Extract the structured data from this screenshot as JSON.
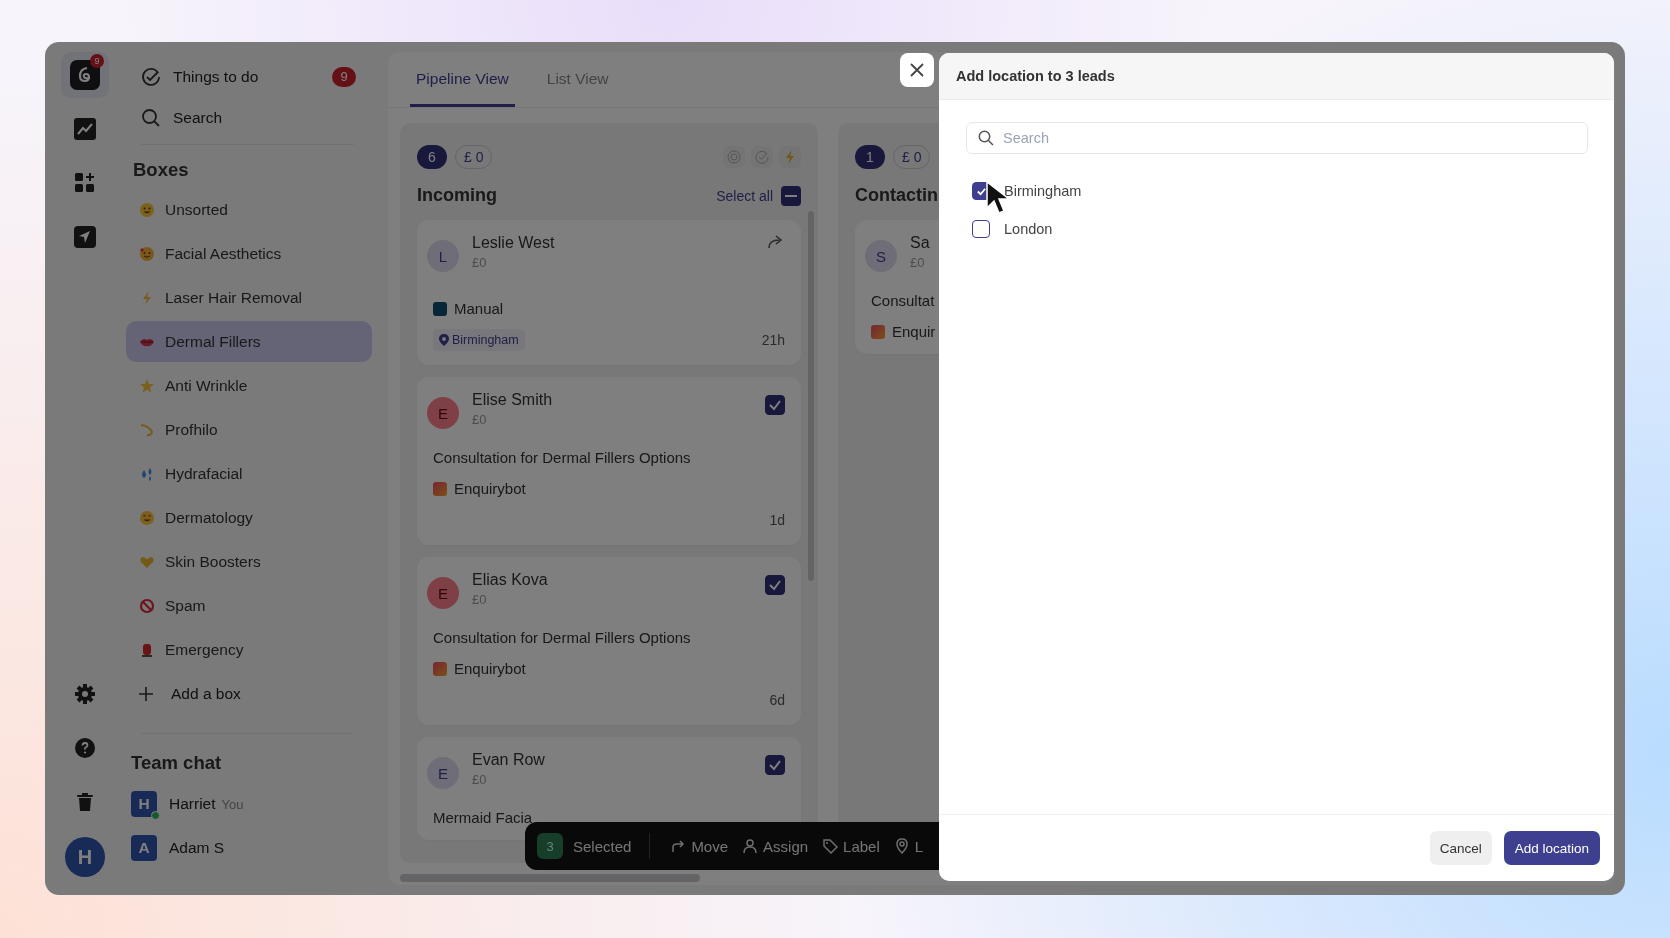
{
  "rail": {
    "logo_badge": "9",
    "avatar": "H"
  },
  "sidebar": {
    "things_to_do": {
      "label": "Things to do",
      "badge": "9"
    },
    "search": "Search",
    "boxes_title": "Boxes",
    "boxes": [
      {
        "label": "Unsorted",
        "selected": false
      },
      {
        "label": "Facial Aesthetics",
        "selected": false
      },
      {
        "label": "Laser Hair Removal",
        "selected": false
      },
      {
        "label": "Dermal Fillers",
        "selected": true
      },
      {
        "label": "Anti Wrinkle",
        "selected": false
      },
      {
        "label": "Profhilo",
        "selected": false
      },
      {
        "label": "Hydrafacial",
        "selected": false
      },
      {
        "label": "Dermatology",
        "selected": false
      },
      {
        "label": "Skin Boosters",
        "selected": false
      },
      {
        "label": "Spam",
        "selected": false
      },
      {
        "label": "Emergency",
        "selected": false
      }
    ],
    "add_box": "Add a box",
    "team_chat_title": "Team chat",
    "team": [
      {
        "initial": "H",
        "name": "Harriet",
        "note": "You",
        "online": true
      },
      {
        "initial": "A",
        "name": "Adam S",
        "online": false
      }
    ]
  },
  "tabs": [
    {
      "label": "Pipeline View",
      "selected": true
    },
    {
      "label": "List View",
      "selected": false
    }
  ],
  "columns": [
    {
      "count": "6",
      "total": "£ 0",
      "title": "Incoming",
      "select_all": "Select all",
      "cards": [
        {
          "initial": "L",
          "color": "#6e6d78",
          "name": "Leslie West",
          "value": "£0",
          "checked": false,
          "source": {
            "kind": "manual",
            "label": "Manual"
          },
          "location": "Birmingham",
          "time": "21h"
        },
        {
          "initial": "E",
          "color": "#7f3f47",
          "name": "Elise Smith",
          "value": "£0",
          "checked": true,
          "subject": "Consultation for Dermal Fillers Options",
          "source": {
            "kind": "enquirybot",
            "label": "Enquirybot"
          },
          "time": "1d"
        },
        {
          "initial": "E",
          "color": "#7f3f47",
          "name": "Elias Kova",
          "value": "£0",
          "checked": true,
          "subject": "Consultation for Dermal Fillers Options",
          "source": {
            "kind": "enquirybot",
            "label": "Enquirybot"
          },
          "time": "6d"
        },
        {
          "initial": "E",
          "color": "#6e6d78",
          "name": "Evan Row",
          "value": "£0",
          "checked": true,
          "subject": "Mermaid Facia"
        }
      ]
    },
    {
      "count": "1",
      "total": "£ 0",
      "title": "Contactin",
      "cards": [
        {
          "initial": "S",
          "color": "#6e6d78",
          "name": "Sa",
          "value": "£0",
          "subject": "Consultat",
          "source": {
            "kind": "enquirybot",
            "label": "Enquir"
          }
        }
      ]
    }
  ],
  "bulk_bar": {
    "count": "3",
    "label": "Selected",
    "actions": [
      {
        "kind": "move",
        "label": "Move"
      },
      {
        "kind": "assign",
        "label": "Assign"
      },
      {
        "kind": "label",
        "label": "Label"
      },
      {
        "kind": "location",
        "label": "L"
      }
    ]
  },
  "modal": {
    "title": "Add location to 3 leads",
    "search": {
      "placeholder": "Search"
    },
    "options": [
      {
        "label": "Birmingham",
        "checked": true
      },
      {
        "label": "London",
        "checked": false
      }
    ],
    "buttons": {
      "cancel": "Cancel",
      "primary": "Add location"
    }
  }
}
